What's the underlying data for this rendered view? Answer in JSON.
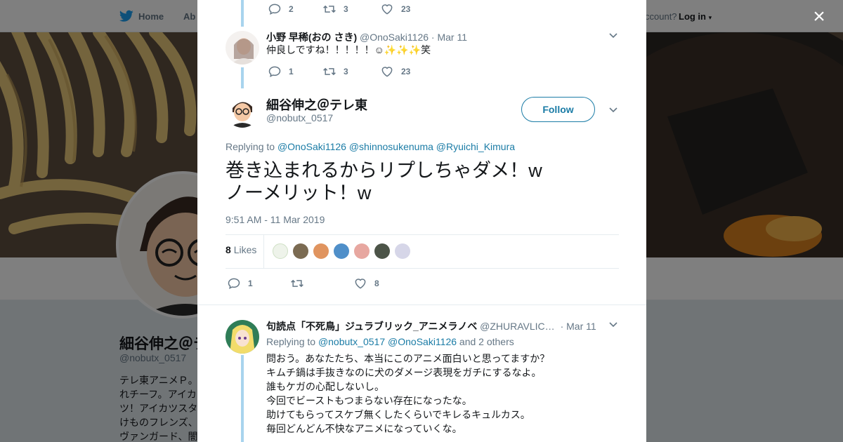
{
  "topbar": {
    "home": "Home",
    "about": "Ab",
    "account_prompt": "ccount?",
    "login": "Log in"
  },
  "background_profile": {
    "name": "細谷伸之＠テ",
    "handle": "@nobutx_0517",
    "bio": [
      "テレ東アニメＰ。",
      "れチーフ。アイカ",
      "ツ！アイカツスタ",
      "けものフレンズ、",
      "ヴァンガード、闇"
    ]
  },
  "close_label": "×",
  "replies_above": [
    {
      "reply": "2",
      "retweet": "3",
      "like": "23"
    }
  ],
  "reply_tweet_1": {
    "name": "小野 早稀(おの さき)",
    "handle": "@OnoSaki1126",
    "date": "· Mar 11",
    "text": "仲良しですね！！！！！☺✨✨✨笑",
    "reply": "1",
    "retweet": "3",
    "like": "23"
  },
  "main_tweet": {
    "name": "細谷伸之＠テレ東",
    "handle": "@nobutx_0517",
    "follow_label": "Follow",
    "replying_prefix": "Replying to",
    "replying_to": [
      "@OnoSaki1126",
      "@shinnosukenuma",
      "@Ryuichi_Kimura"
    ],
    "text_line1": "巻き込まれるからリプしちゃダメ！w",
    "text_line2": "ノーメリット！w",
    "timestamp": "9:51 AM - 11 Mar 2019",
    "likes_count": "8",
    "likes_label": "Likes",
    "reply": "1",
    "like": "8"
  },
  "reply_tweet_2": {
    "name": "句読点「不死鳥」ジュラブリック_アニメラノベ",
    "handle": "@ZHURAVLIC…",
    "date": "· Mar 11",
    "replying_prefix": "Replying to",
    "replying_to": [
      "@nobutx_0517",
      "@OnoSaki1126"
    ],
    "replying_suffix": "and 2 others",
    "lines": [
      "問おう。あなたたち、本当にこのアニメ面白いと思ってますか？",
      "キムチ鍋は手抜きなのに犬のダメージ表現をガチにするなよ。",
      "誰もケガの心配しないし。",
      "今回でビーストもつまらない存在になったな。",
      "助けてもらってスケブ無くしたくらいでキレるキュルカス。",
      "毎回どんどん不快なアニメになっていくな。"
    ]
  },
  "colors": {
    "link": "#1b7ca6",
    "thread": "#a8d4ee",
    "muted": "#657786"
  }
}
